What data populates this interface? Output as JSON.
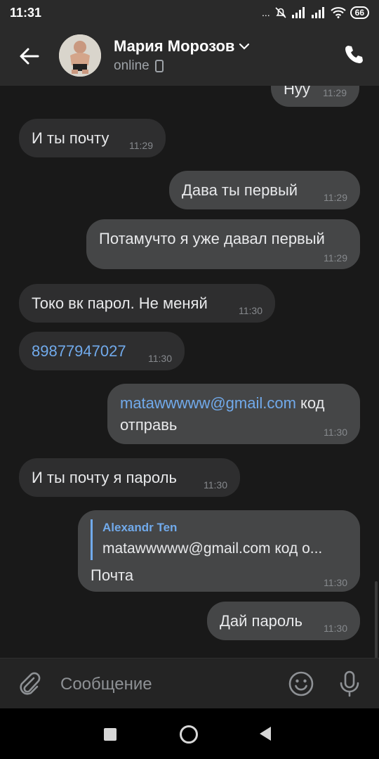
{
  "status_bar": {
    "time": "11:31",
    "battery": "66",
    "indicators": "... "
  },
  "header": {
    "contact_name": "Мария Морозов",
    "status": "online"
  },
  "messages": [
    {
      "dir": "out",
      "text": "Нуу",
      "time": "11:29"
    },
    {
      "dir": "in",
      "text": "И ты почту",
      "time": "11:29"
    },
    {
      "dir": "out",
      "text": "Дава ты первый",
      "time": "11:29"
    },
    {
      "dir": "out",
      "text": "Потамучто я уже давал первый",
      "time": "11:29"
    },
    {
      "dir": "in",
      "text": "Токо вк парол. Не меняй",
      "time": "11:30"
    },
    {
      "dir": "in",
      "link": "89877947027",
      "time": "11:30"
    },
    {
      "dir": "out",
      "link": "matawwwww@gmail.com",
      "text_after": " код",
      "text_line2": "отправь",
      "time": "11:30"
    },
    {
      "dir": "in",
      "text": "И ты почту я пароль",
      "time": "11:30"
    },
    {
      "dir": "out",
      "reply_author": "Alexandr Ten",
      "reply_text": "matawwwww@gmail.com код о...",
      "text": "Почта",
      "time": "11:30"
    },
    {
      "dir": "out",
      "text": "Дай пароль",
      "time": "11:30"
    }
  ],
  "input": {
    "placeholder": "Сообщение"
  },
  "icons": {
    "back": "arrow-left-icon",
    "phone": "phone-icon",
    "attach": "paperclip-icon",
    "emoji": "smile-icon",
    "mic": "microphone-icon",
    "device": "mobile-device-icon"
  },
  "colors": {
    "link": "#71aaeb",
    "incoming_bubble": "#2e2e2f",
    "outgoing_bubble": "#454647",
    "background": "#191919"
  }
}
